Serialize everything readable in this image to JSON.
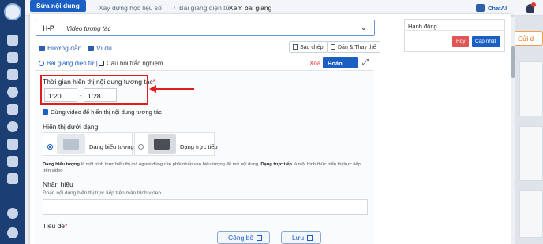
{
  "topbar": {
    "active_tab": "Sửa nội dung",
    "breadcrumbs": [
      "Xây dựng học liệu số",
      "Bài giảng điện tử",
      "Xem bài giảng"
    ],
    "chatai": "ChatAI",
    "right_chip": "Gửi d"
  },
  "content_type": {
    "logo": "H-P",
    "selected": "Video tương tác"
  },
  "guide": {
    "instructions": "Hướng dẫn",
    "example": "Ví dụ"
  },
  "toolbar": {
    "copy": "Sao chép",
    "paste_replace": "Dán & Thay thế"
  },
  "editor_tabs": {
    "lecture": "Bài giảng điện tử",
    "quiz": "Câu hỏi trắc nghiệm",
    "delete": "Xóa",
    "done": "Hoàn thành"
  },
  "form": {
    "time_label": "Thời gian hiển thị nội dung tương tác",
    "required": "*",
    "time_start": "1:20",
    "time_end": "1:28",
    "pause_video": "Dừng video để hiển thị nội dung tương tác",
    "display_as": "Hiển thị dưới dạng",
    "option_icon": "Dạng biểu tượng",
    "option_direct": "Dạng trực tiếp",
    "help_bold_1": "Dạng biểu tượng",
    "help_1": "là một hình thức hiển thị mà người dùng cần phải nhấn vào biểu tượng để mở nội dung.",
    "help_bold_2": "Dạng trực tiếp",
    "help_2": "là một hình thức hiển thị trực tiếp trên video",
    "label_field": "Nhãn hiệu",
    "label_field_desc": "Đoạn nội dung hiển thị trực tiếp trên màn hình video",
    "title_field": "Tiêu đề"
  },
  "actions": {
    "title": "Hành động",
    "cancel": "Hủy",
    "update": "Cập nhật"
  },
  "footer": {
    "publish": "Công bố",
    "save": "Lưu"
  },
  "colors": {
    "primary": "#1c5fc4",
    "sidebar": "#1c3f73",
    "danger": "#e01e1e"
  }
}
